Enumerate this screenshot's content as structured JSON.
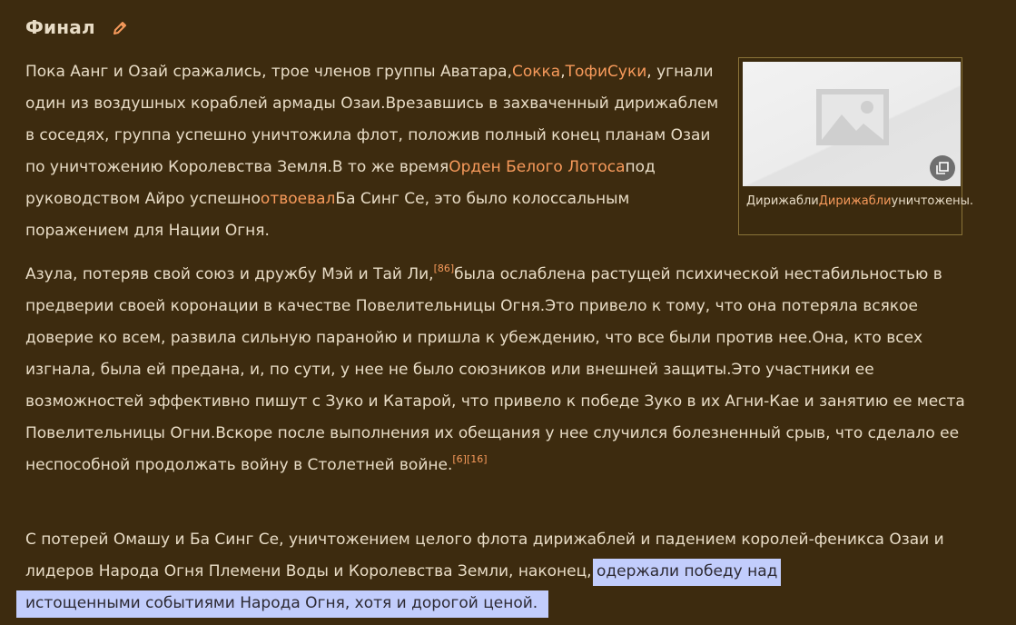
{
  "section": {
    "heading": "Финал"
  },
  "paragraph1": {
    "t1": "Пока Аанг и Озай сражались, трое членов группы Аватара,",
    "link_sokka": "Сокка",
    "sep1": ",",
    "link_toph": "Тофи",
    "link_suki": "Суки",
    "t2": ", угнали один из воздушных кораблей армады Озаи.Врезавшись в захваченный дирижаблем в соседях, группа успешно уничтожила флот, положив полный конец планам Озаи по уничтожению Королевства Земля.В то же время",
    "link_order": "Орден Белого Лотоса",
    "t3": "под руководством Айро успешно",
    "link_reclaimed": "отвоевал",
    "t4": "Ба Синг Се, это было колоссальным поражением для Нации Огня."
  },
  "paragraph2": {
    "t1": "Азула, потеряв свой союз и дружбу Мэй и Тай Ли,",
    "ref1": "[86]",
    "t2": "была ослаблена растущей психической нестабильностью в предверии своей коронации в качестве Повелительницы Огня.Это привело к тому, что она потеряла всякое доверие ко всем, развила сильную паранойю и пришла к убеждению, что все были против нее.Она, кто всех изгнала, была ей предана, и, по сути, у нее не было союзников или внешней защиты.Это участники ее возможностей эффективно пишут с Зуко и Катарой, что привело к победе Зуко в их Агни-Кае и занятию ее места Повелительницы Огни.Вскоре после выполнения их обещания у нее случился болезненный срыв, что сделало ее неспособной продолжать войну в Столетней войне.",
    "ref2": "[6]",
    "ref3": "[16]"
  },
  "paragraph3": {
    "t1": "С потерей Омашу и Ба Синг Се, уничтожением целого флота дирижаблей и падением королей-феникса Озаи и лидеров Народа Огня Племени Воды и Королевства Земли, наконец,",
    "highlight1": "одержали победу над",
    "highlight2": "истощенными событиями Народа Огня, хотя и дорогой ценой."
  },
  "figure": {
    "caption_t1": "Дирижабли",
    "caption_link": "Дирижабли",
    "caption_t2": "уничтожены."
  },
  "colors": {
    "background": "#3d2b0f",
    "text": "#e8dcc6",
    "link": "#f79a5b",
    "highlight": "#c2cdfc"
  },
  "icons": {
    "edit": "pencil-icon",
    "image_placeholder": "image-placeholder-icon",
    "expand": "expand-icon"
  }
}
